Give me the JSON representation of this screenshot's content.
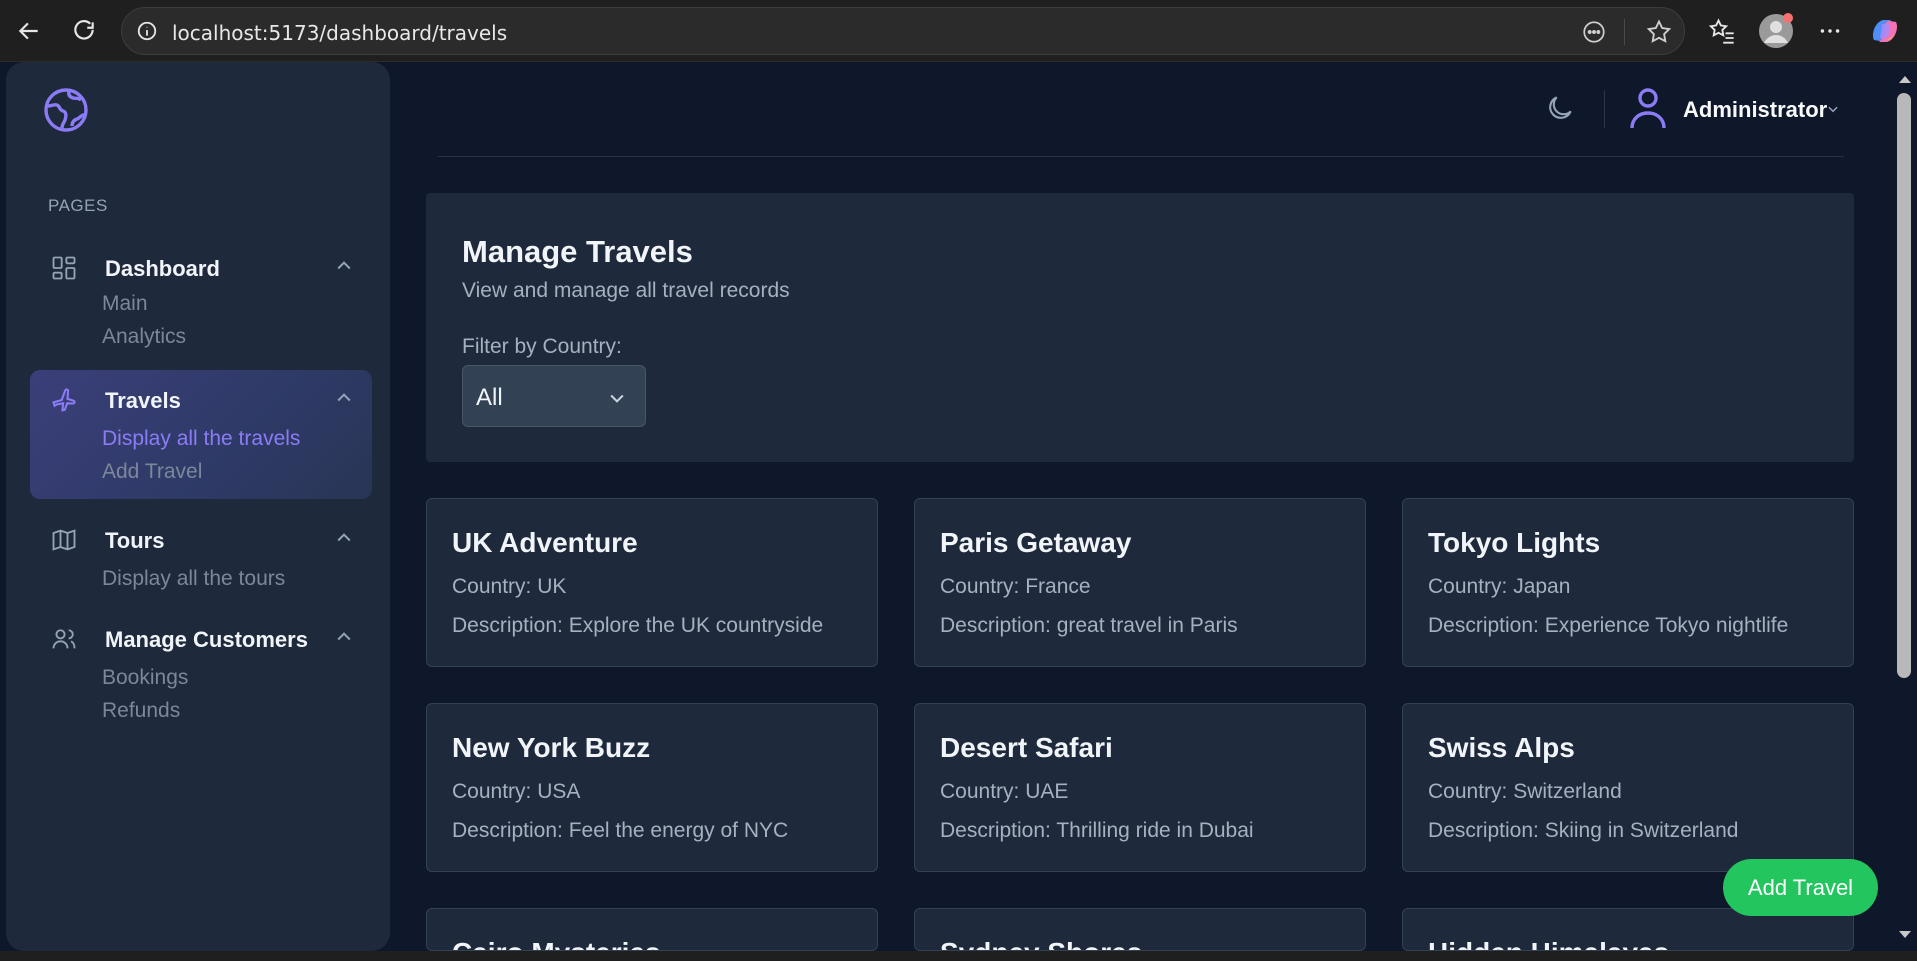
{
  "browser": {
    "url": "localhost:5173/dashboard/travels"
  },
  "sidebar": {
    "section_title": "PAGES",
    "groups": [
      {
        "label": "Dashboard",
        "items": [
          "Main",
          "Analytics"
        ]
      },
      {
        "label": "Travels",
        "items": [
          "Display all the travels",
          "Add Travel"
        ]
      },
      {
        "label": "Tours",
        "items": [
          "Display all the tours"
        ]
      },
      {
        "label": "Manage Customers",
        "items": [
          "Bookings",
          "Refunds"
        ]
      }
    ]
  },
  "header": {
    "user_name": "Administrator"
  },
  "panel": {
    "title": "Manage Travels",
    "subtitle": "View and manage all travel records",
    "filter_label": "Filter by Country:",
    "filter_value": "All"
  },
  "cards": [
    {
      "title": "UK Adventure",
      "country": "Country: UK",
      "description": "Description: Explore the UK countryside"
    },
    {
      "title": "Paris Getaway",
      "country": "Country: France",
      "description": "Description: great travel in Paris"
    },
    {
      "title": "Tokyo Lights",
      "country": "Country: Japan",
      "description": "Description: Experience Tokyo nightlife"
    },
    {
      "title": "New York Buzz",
      "country": "Country: USA",
      "description": "Description: Feel the energy of NYC"
    },
    {
      "title": "Desert Safari",
      "country": "Country: UAE",
      "description": "Description: Thrilling ride in Dubai"
    },
    {
      "title": "Swiss Alps",
      "country": "Country: Switzerland",
      "description": "Description: Skiing in Switzerland"
    },
    {
      "title": "Cairo Mysteries",
      "country": "",
      "description": ""
    },
    {
      "title": "Sydney Shores",
      "country": "",
      "description": ""
    },
    {
      "title": "Hidden Himalayas",
      "country": "",
      "description": ""
    }
  ],
  "add_button_label": "Add Travel",
  "colors": {
    "accent": "#8b7cf6",
    "add_button": "#22c55e",
    "background": "#0f172a",
    "surface": "#1e293b"
  }
}
